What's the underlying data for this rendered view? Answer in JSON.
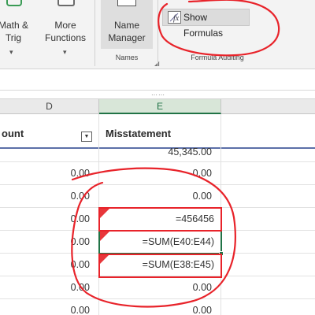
{
  "ribbon": {
    "math_trig": {
      "line1": "Math &",
      "line2": "Trig"
    },
    "more_functions": {
      "line1": "More",
      "line2": "Functions"
    },
    "name_manager": {
      "line1": "Name",
      "line2": "Manager"
    },
    "names_group_label": "Names",
    "show_formulas_label": "Show Formulas",
    "formula_auditing_label": "Formula Auditing"
  },
  "columns": {
    "d_header": "D",
    "e_header": "E"
  },
  "table": {
    "d_title": "ount",
    "e_title": "Misstatement",
    "rows": [
      {
        "d": "",
        "e": "45,345.00"
      },
      {
        "d": "0.00",
        "e": "0.00"
      },
      {
        "d": "0.00",
        "e": "0.00"
      },
      {
        "d": "0.00",
        "e": "=456456"
      },
      {
        "d": "0.00",
        "e": "=SUM(E40:E44)"
      },
      {
        "d": "0.00",
        "e": "=SUM(E38:E45)"
      },
      {
        "d": "0.00",
        "e": "0.00"
      },
      {
        "d": "0.00",
        "e": "0.00"
      }
    ]
  },
  "colors": {
    "accent": "#217346",
    "annotation": "#e8232a",
    "error_indicator": "#e8363a",
    "table_header_rule": "#5b6fa8"
  },
  "icons": {
    "fx": "show-formulas-icon",
    "filter": "filter-dropdown-icon"
  }
}
